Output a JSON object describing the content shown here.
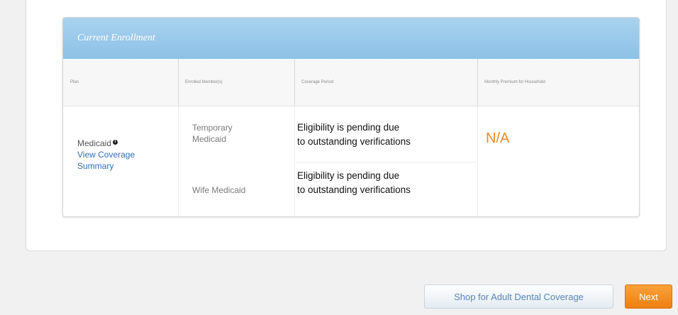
{
  "enrollment": {
    "title": "Current Enrollment",
    "columns": [
      "Plan",
      "Enrolled Member(s)",
      "Coverage Period",
      "Monthly Premium for Household"
    ],
    "plan": {
      "name": "Medicaid",
      "info_icon": "info-icon",
      "link_line1": "View Coverage",
      "link_line2": "Summary"
    },
    "rows": [
      {
        "member_line1": "Temporary",
        "member_line2": "Medicaid",
        "period_line1": "Eligibility is pending due",
        "period_line2": "to outstanding verifications"
      },
      {
        "member_line1": "Wife Medicaid",
        "period_line1": "Eligibility is pending due",
        "period_line2": "to outstanding verifications"
      }
    ],
    "premium": "N/A"
  },
  "actions": {
    "shop_label": "Shop for Adult Dental Coverage",
    "next_label": "Next"
  },
  "colors": {
    "header_blue": "#9ccbec",
    "premium_orange": "#f08a24",
    "link_blue": "#2f6fb5",
    "next_orange": "#f29022"
  }
}
